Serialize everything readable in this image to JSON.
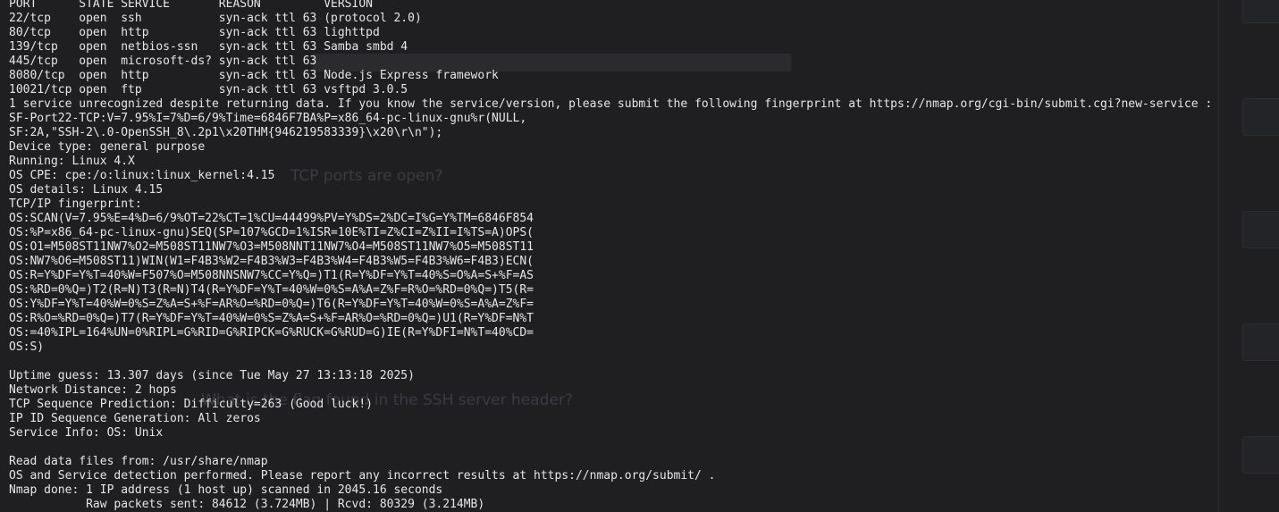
{
  "terminal": {
    "lines": [
      "PORT      STATE SERVICE       REASON         VERSION",
      "22/tcp    open  ssh           syn-ack ttl 63 (protocol 2.0)",
      "80/tcp    open  http          syn-ack ttl 63 lighttpd",
      "139/tcp   open  netbios-ssn   syn-ack ttl 63 Samba smbd 4",
      "445/tcp   open  microsoft-ds? syn-ack ttl 63",
      "8080/tcp  open  http          syn-ack ttl 63 Node.js Express framework",
      "10021/tcp open  ftp           syn-ack ttl 63 vsftpd 3.0.5",
      "1 service unrecognized despite returning data. If you know the service/version, please submit the following fingerprint at https://nmap.org/cgi-bin/submit.cgi?new-service :",
      "SF-Port22-TCP:V=7.95%I=7%D=6/9%Time=6846F7BA%P=x86_64-pc-linux-gnu%r(NULL,",
      "SF:2A,\"SSH-2\\.0-OpenSSH_8\\.2p1\\x20THM{946219583339}\\x20\\r\\n\");",
      "Device type: general purpose",
      "Running: Linux 4.X",
      "OS CPE: cpe:/o:linux:linux_kernel:4.15",
      "OS details: Linux 4.15",
      "TCP/IP fingerprint:",
      "OS:SCAN(V=7.95%E=4%D=6/9%OT=22%CT=1%CU=44499%PV=Y%DS=2%DC=I%G=Y%TM=6846F854",
      "OS:%P=x86_64-pc-linux-gnu)SEQ(SP=107%GCD=1%ISR=10E%TI=Z%CI=Z%II=I%TS=A)OPS(",
      "OS:O1=M508ST11NW7%O2=M508ST11NW7%O3=M508NNT11NW7%O4=M508ST11NW7%O5=M508ST11",
      "OS:NW7%O6=M508ST11)WIN(W1=F4B3%W2=F4B3%W3=F4B3%W4=F4B3%W5=F4B3%W6=F4B3)ECN(",
      "OS:R=Y%DF=Y%T=40%W=F507%O=M508NNSNW7%CC=Y%Q=)T1(R=Y%DF=Y%T=40%S=O%A=S+%F=AS",
      "OS:%RD=0%Q=)T2(R=N)T3(R=N)T4(R=Y%DF=Y%T=40%W=0%S=A%A=Z%F=R%O=%RD=0%Q=)T5(R=",
      "OS:Y%DF=Y%T=40%W=0%S=Z%A=S+%F=AR%O=%RD=0%Q=)T6(R=Y%DF=Y%T=40%W=0%S=A%A=Z%F=",
      "OS:R%O=%RD=0%Q=)T7(R=Y%DF=Y%T=40%W=0%S=Z%A=S+%F=AR%O=%RD=0%Q=)U1(R=Y%DF=N%T",
      "OS:=40%IPL=164%UN=0%RIPL=G%RID=G%RIPCK=G%RUCK=G%RUD=G)IE(R=Y%DFI=N%T=40%CD=",
      "OS:S)",
      "",
      "Uptime guess: 13.307 days (since Tue May 27 13:13:18 2025)",
      "Network Distance: 2 hops",
      "TCP Sequence Prediction: Difficulty=263 (Good luck!)",
      "IP ID Sequence Generation: All zeros",
      "Service Info: OS: Unix",
      "",
      "Read data files from: /usr/share/nmap",
      "OS and Service detection performed. Please report any incorrect results at https://nmap.org/submit/ .",
      "Nmap done: 1 IP address (1 host up) scanned in 2045.16 seconds",
      "           Raw packets sent: 84612 (3.724MB) | Rcvd: 80329 (3.214MB)"
    ]
  },
  "background_page": {
    "question_1": "TCP ports are open?",
    "question_2": "What is the flag found in the SSH server header?"
  },
  "colors": {
    "terminal_bg": "#1f1f22",
    "terminal_text": "#e6e6e6",
    "faint_bg_text": "#3a3c42"
  }
}
